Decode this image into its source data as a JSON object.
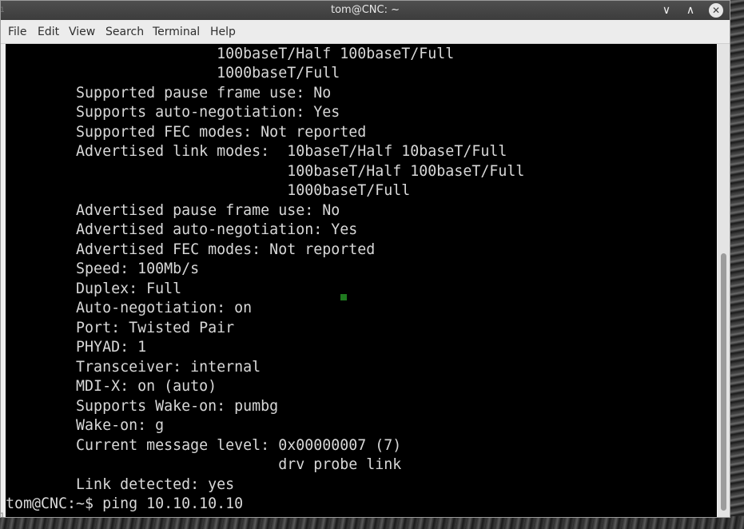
{
  "window": {
    "title": "tom@CNC: ~",
    "controls": {
      "minimize": "∨",
      "maximize": "∧",
      "close": "✕"
    }
  },
  "menubar": {
    "items": [
      "File",
      "Edit",
      "View",
      "Search",
      "Terminal",
      "Help"
    ]
  },
  "terminal": {
    "lines": [
      "                        100baseT/Half 100baseT/Full",
      "                        1000baseT/Full",
      "        Supported pause frame use: No",
      "        Supports auto-negotiation: Yes",
      "        Supported FEC modes: Not reported",
      "        Advertised link modes:  10baseT/Half 10baseT/Full",
      "                                100baseT/Half 100baseT/Full",
      "                                1000baseT/Full",
      "        Advertised pause frame use: No",
      "        Advertised auto-negotiation: Yes",
      "        Advertised FEC modes: Not reported",
      "        Speed: 100Mb/s",
      "        Duplex: Full",
      "        Auto-negotiation: on",
      "        Port: Twisted Pair",
      "        PHYAD: 1",
      "        Transceiver: internal",
      "        MDI-X: on (auto)",
      "        Supports Wake-on: pumbg",
      "        Wake-on: g",
      "        Current message level: 0x00000007 (7)",
      "                               drv probe link",
      "        Link detected: yes",
      "tom@CNC:~$ ping 10.10.10.10"
    ],
    "colors": {
      "background": "#000000",
      "foreground": "#d8d8d8",
      "cursor": "#1f7a1f"
    }
  },
  "edge_marks": [
    "1",
    "1"
  ]
}
